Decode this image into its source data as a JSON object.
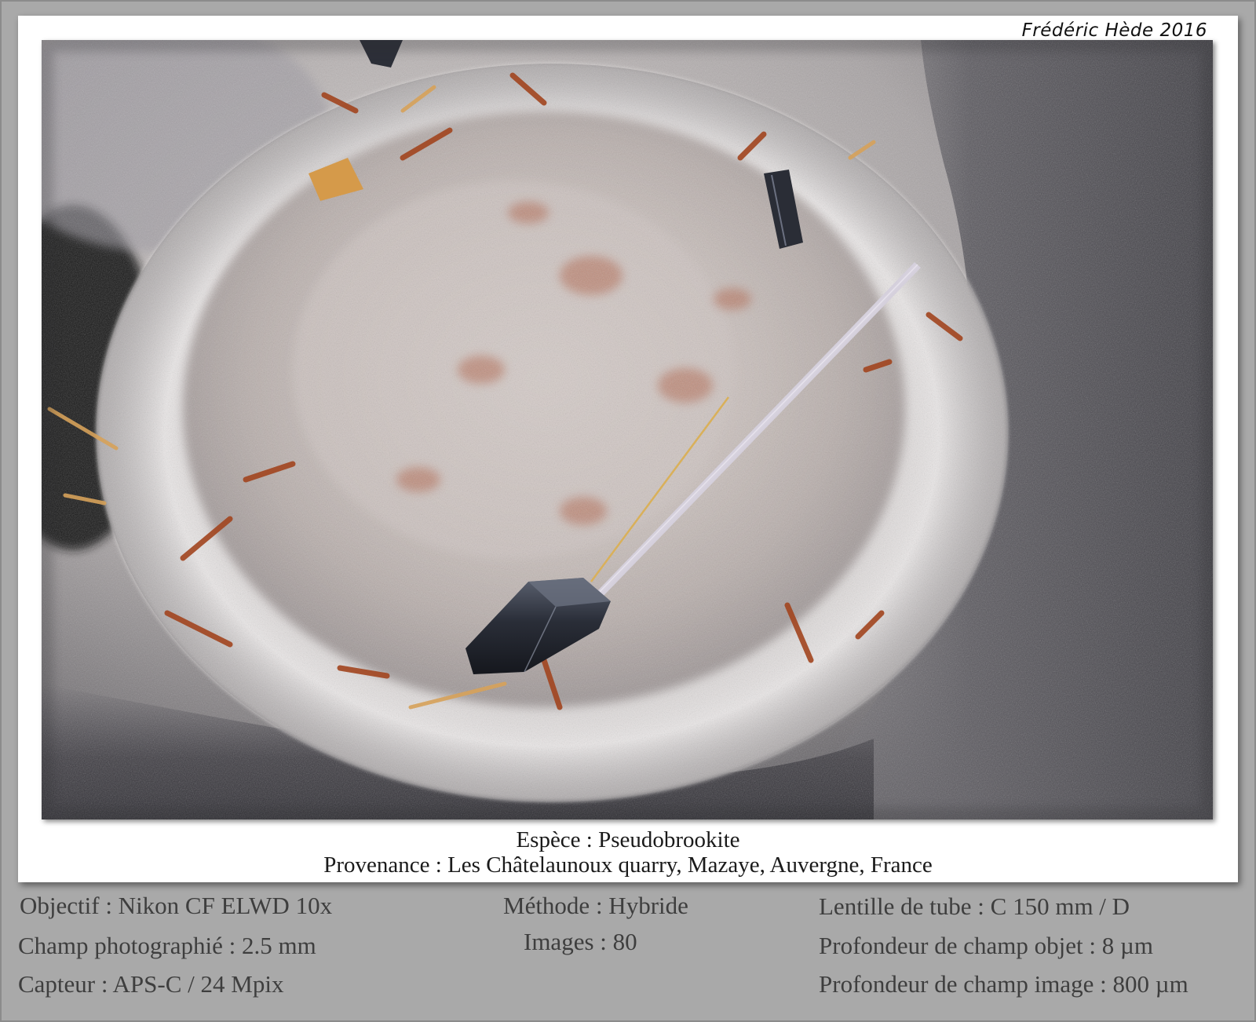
{
  "credit": "Frédéric Hède 2016",
  "photo": {
    "subject": "pseudobrookite-crystal-macro"
  },
  "caption": {
    "species": "Espèce : Pseudobrookite",
    "origin": "Provenance : Les Châtelaunoux quarry, Mazaye, Auvergne, France"
  },
  "metadata": {
    "left": [
      "Objectif : Nikon CF ELWD 10x",
      "Champ photographié : 2.5 mm",
      "Capteur : APS-C / 24 Mpix"
    ],
    "center": [
      "Méthode : Hybride",
      "Images : 80"
    ],
    "right": [
      "Lentille de tube : C 150 mm / D",
      "Profondeur de champ objet : 8 µm",
      "Profondeur de champ image : 800 µm"
    ]
  },
  "colors": {
    "background": "#a9a9a9",
    "card": "#ffffff",
    "metadata_text": "#3e3e3e",
    "caption_text": "#1a1a1a"
  }
}
